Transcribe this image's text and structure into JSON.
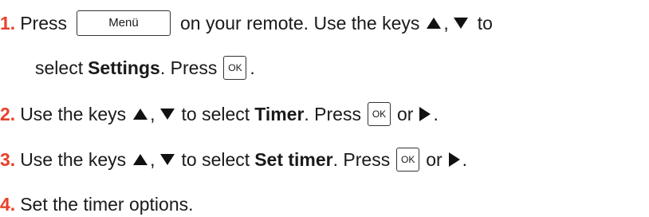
{
  "steps": [
    {
      "number": "1.",
      "pre": "Press",
      "key": "Menü",
      "after_key": "on your remote. Use the keys",
      "comma": ",",
      "to": "to",
      "line2_pre": "select",
      "bold": "Settings",
      "line2_mid": ". Press",
      "ok": "OK",
      "end": "."
    },
    {
      "number": "2.",
      "pre": "Use the keys",
      "comma": ",",
      "mid": "to select",
      "bold": "Timer",
      "press": ". Press",
      "ok": "OK",
      "or": "or",
      "end": "."
    },
    {
      "number": "3.",
      "pre": "Use the keys",
      "comma": ",",
      "mid": "to select",
      "bold": "Set timer",
      "press": ". Press",
      "ok": "OK",
      "or": "or",
      "end": "."
    },
    {
      "number": "4.",
      "text": "Set the timer options."
    }
  ],
  "icons": {
    "up": "up-arrow-icon",
    "down": "down-arrow-icon",
    "right": "right-arrow-icon"
  }
}
